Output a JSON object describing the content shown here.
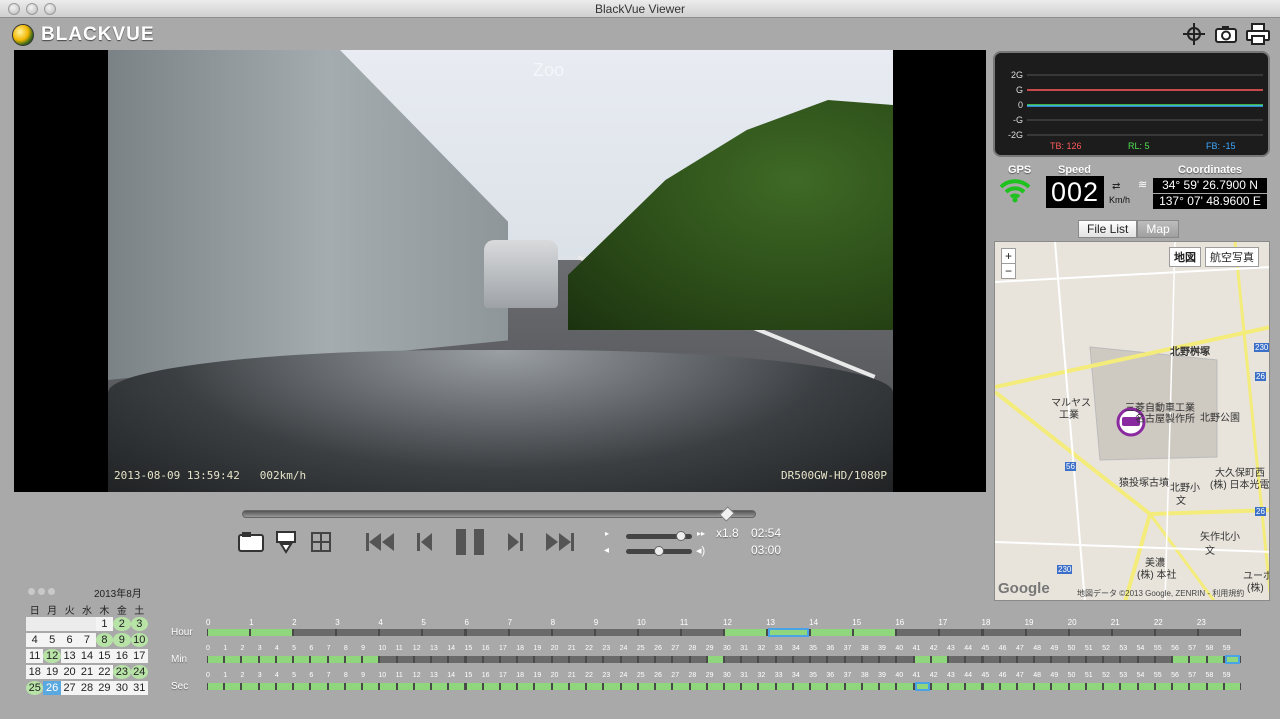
{
  "window": {
    "title": "BlackVue Viewer"
  },
  "brand": {
    "name": "BLACKVUE"
  },
  "header_icons": [
    {
      "name": "crosshair-icon"
    },
    {
      "name": "camera-icon"
    },
    {
      "name": "printer-icon"
    }
  ],
  "video": {
    "zoom_text": "Zoo",
    "timestamp": "2013-08-09 13:59:42",
    "speed_overlay": "002km/h",
    "model": "DR500GW-HD/1080P"
  },
  "gsensor": {
    "axis_labels": [
      "2G",
      "G",
      "0",
      "-G",
      "-2G"
    ],
    "readouts": [
      {
        "label": "TB: 126",
        "color": "#ff5a5a"
      },
      {
        "label": "RL: 5",
        "color": "#4fe04f"
      },
      {
        "label": "FB: -15",
        "color": "#3ca8ff"
      }
    ]
  },
  "gps": {
    "gps_label": "GPS",
    "speed_label": "Speed",
    "speed_value": "002",
    "speed_unit": "Km/h",
    "coordinates_label": "Coordinates",
    "lat": "34° 59' 26.7900 N",
    "lon": "137° 07' 48.9600 E"
  },
  "tabs": [
    {
      "label": "File List",
      "active": true
    },
    {
      "label": "Map",
      "active": false
    }
  ],
  "map": {
    "zoom_in": "+",
    "zoom_out": "−",
    "type_map": "地図",
    "type_aerial": "航空写真",
    "labels": [
      {
        "text": "北野桝塚"
      },
      {
        "text": "マルヤス"
      },
      {
        "text": "工業"
      },
      {
        "text": "三菱自動車工業"
      },
      {
        "text": "名古屋製作所"
      },
      {
        "text": "北野公園"
      },
      {
        "text": "猿投塚古墳"
      },
      {
        "text": "北野小"
      },
      {
        "text": "文"
      },
      {
        "text": "大久保町西"
      },
      {
        "text": "(株) 日本光電"
      },
      {
        "text": "矢作北小"
      },
      {
        "text": "文"
      },
      {
        "text": "美濃"
      },
      {
        "text": "(株) 本社"
      },
      {
        "text": "ユーボ"
      },
      {
        "text": "(株)"
      }
    ],
    "routes": [
      "230",
      "56",
      "26",
      "230",
      "26"
    ],
    "google": "Google",
    "footer": "地図データ ©2013 Google, ZENRIN - 利用規約"
  },
  "playback": {
    "progress": 0.95,
    "speed": "x1.8",
    "current": "02:54",
    "total": "03:00",
    "volume": 0.9,
    "balance": 0.5
  },
  "calendar": {
    "month_label": "2013年8月",
    "weekdays": [
      "日",
      "月",
      "火",
      "水",
      "木",
      "金",
      "土"
    ],
    "days": [
      "",
      "",
      "",
      "",
      "1",
      "2",
      "3",
      "4",
      "5",
      "6",
      "7",
      "8",
      "9",
      "10",
      "11",
      "12",
      "13",
      "14",
      "15",
      "16",
      "17",
      "18",
      "19",
      "20",
      "21",
      "22",
      "23",
      "24",
      "25",
      "26",
      "27",
      "28",
      "29",
      "30",
      "31"
    ],
    "recorded": [
      "2",
      "3",
      "8",
      "9",
      "10",
      "12",
      "23",
      "24",
      "25"
    ],
    "selected": "26"
  },
  "timeline": {
    "hour_label": "Hour",
    "min_label": "Min",
    "sec_label": "Sec",
    "hour_recorded": [
      [
        0,
        1
      ],
      [
        12,
        15
      ]
    ],
    "hour_selected": 13,
    "min_recorded": [
      [
        0,
        9
      ],
      [
        29,
        29
      ],
      [
        41,
        42
      ],
      [
        56,
        59
      ]
    ],
    "min_selected": 59,
    "sec_recorded": [
      [
        0,
        59
      ]
    ],
    "sec_selected": 41
  }
}
